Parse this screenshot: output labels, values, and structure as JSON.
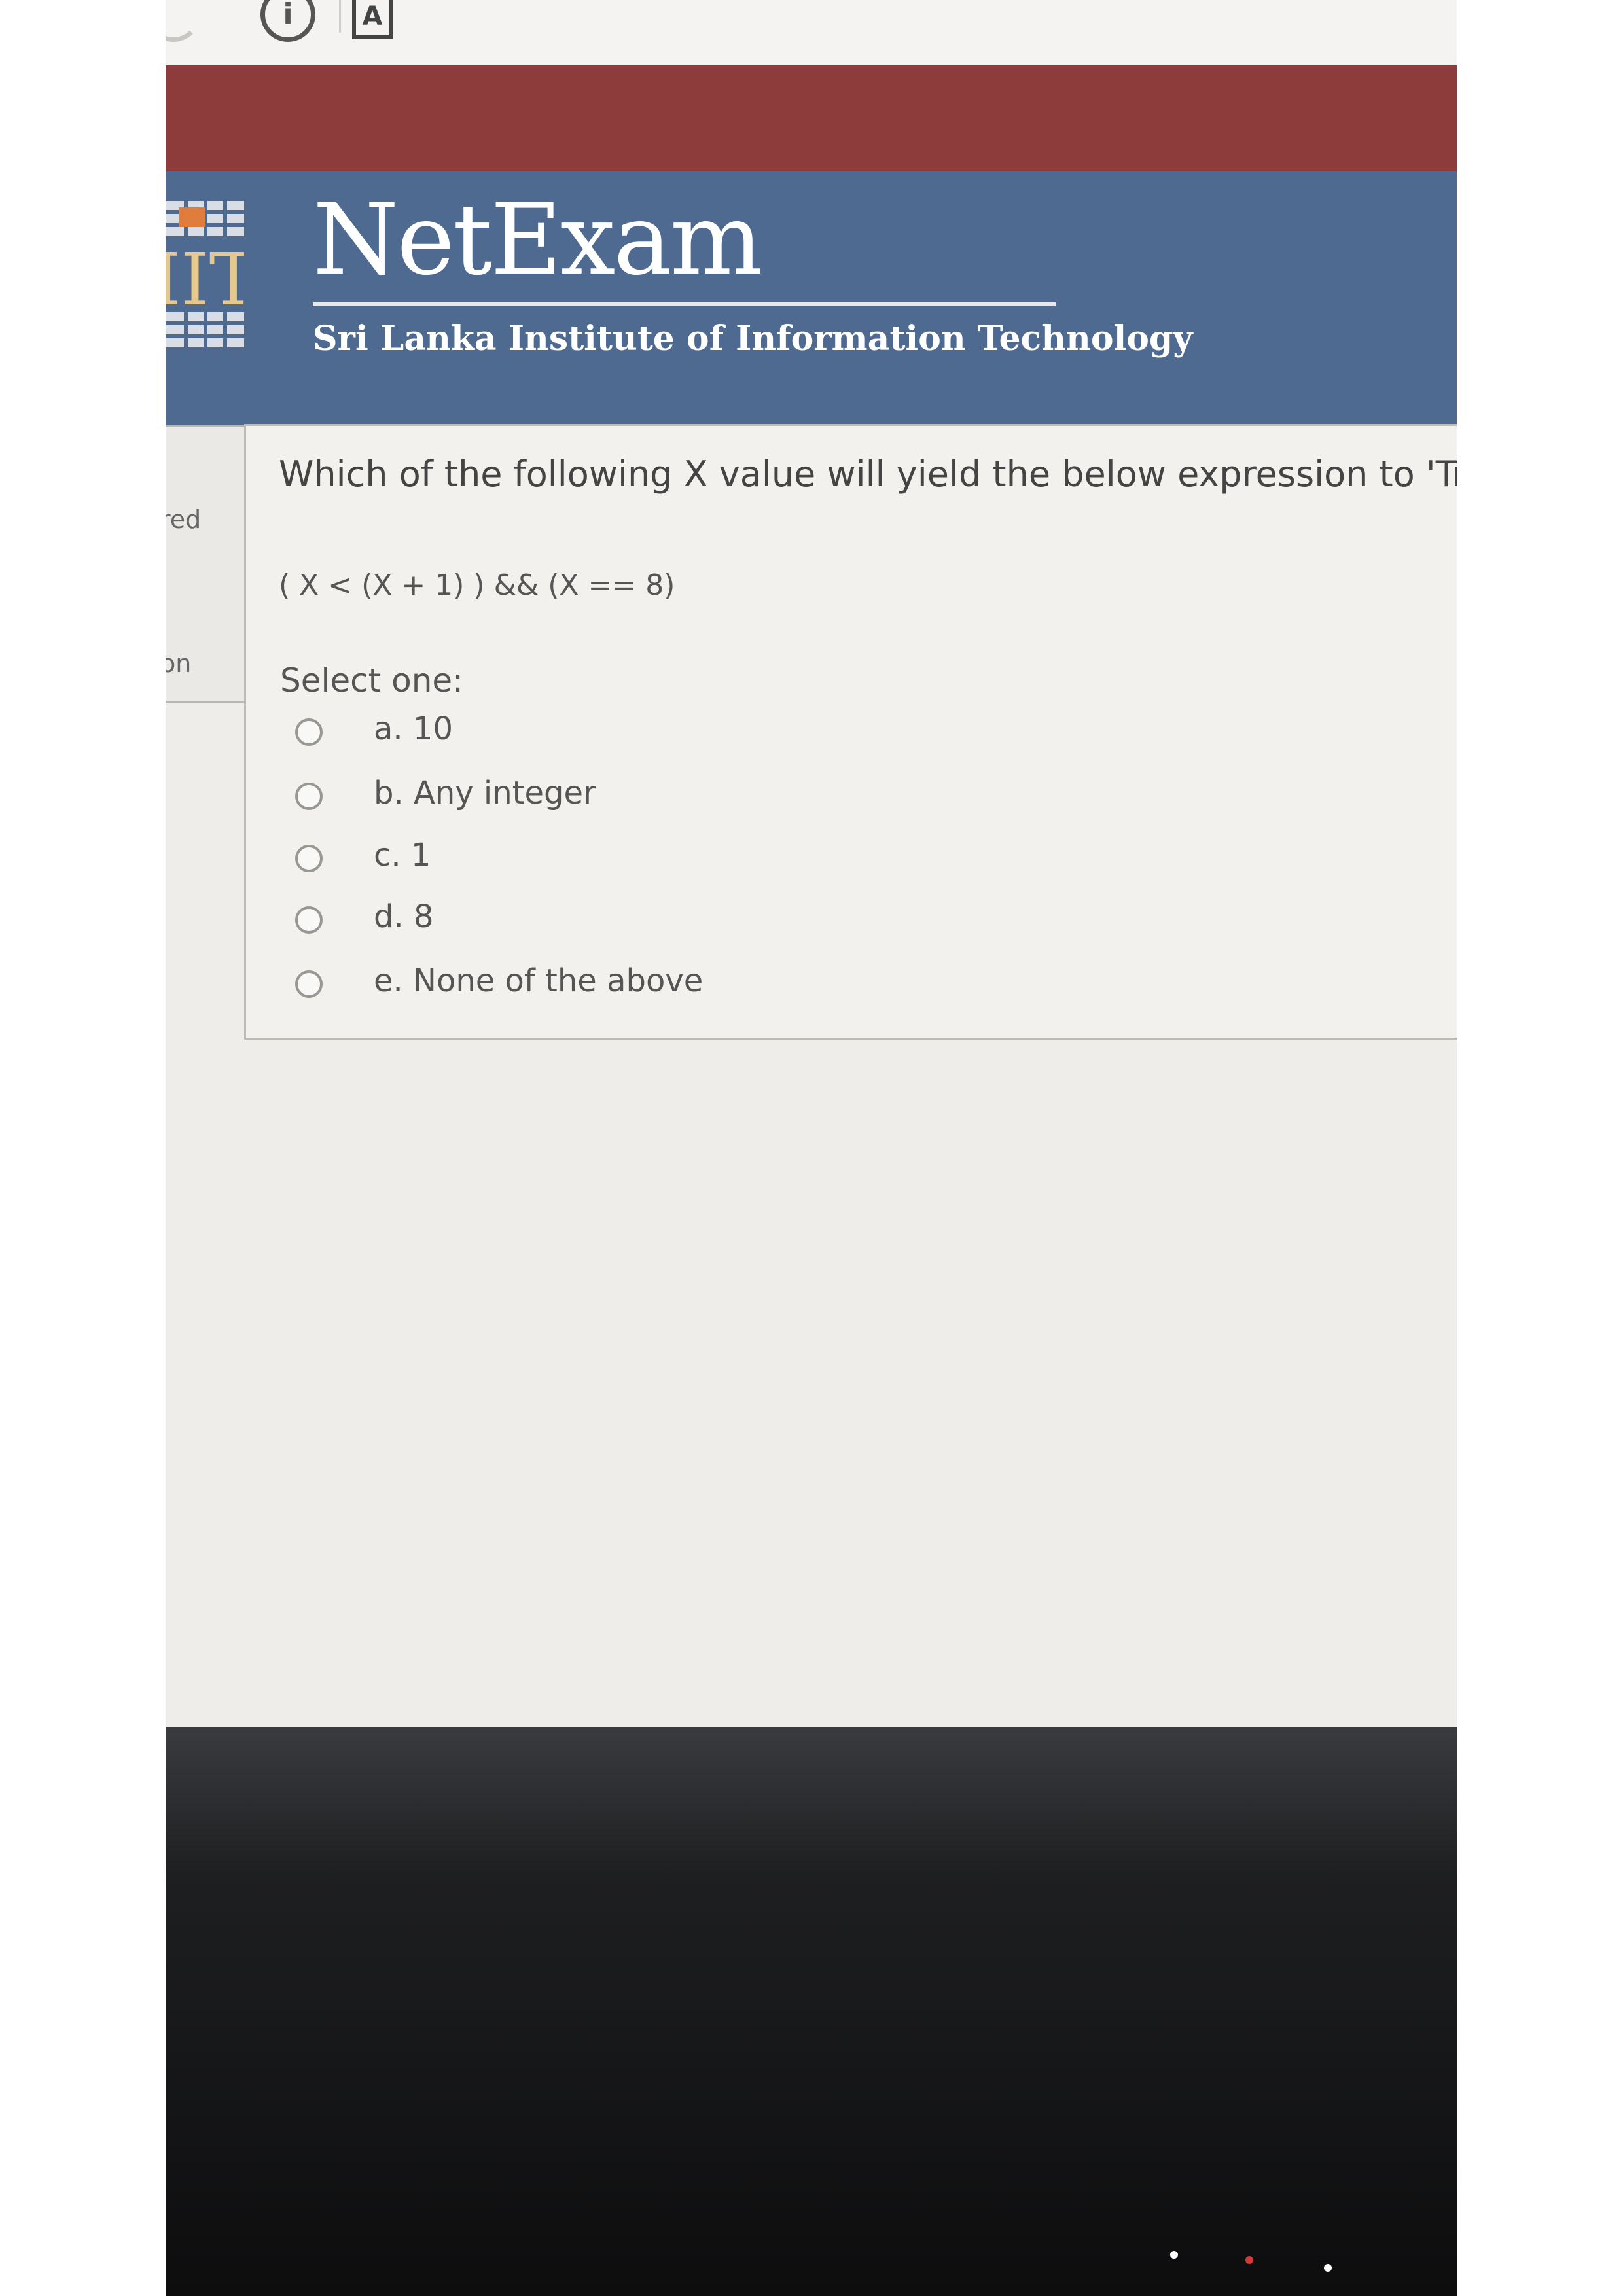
{
  "browser": {
    "info_icon": "info-icon",
    "reader_icon_label": "A"
  },
  "header": {
    "app_title": "NetExam",
    "institute": "Sri Lanka Institute of Information Technology",
    "logo_text": "IIT",
    "colors": {
      "maroon": "#8e3b3c",
      "blue": "#4f6a90",
      "accent": "#e07d3c"
    }
  },
  "nav": {
    "status_partial": "red",
    "section_partial": "on"
  },
  "question": {
    "text": "Which of the following X value will yield the below expression to 'True'?",
    "expression": "( X < (X + 1) ) && (X == 8)",
    "select_label": "Select one:",
    "options": [
      {
        "label": "a. 10",
        "selected": false
      },
      {
        "label": "b. Any integer",
        "selected": false
      },
      {
        "label": "c. 1",
        "selected": false
      },
      {
        "label": "d. 8",
        "selected": false
      },
      {
        "label": "e. None of the above",
        "selected": false
      }
    ]
  }
}
